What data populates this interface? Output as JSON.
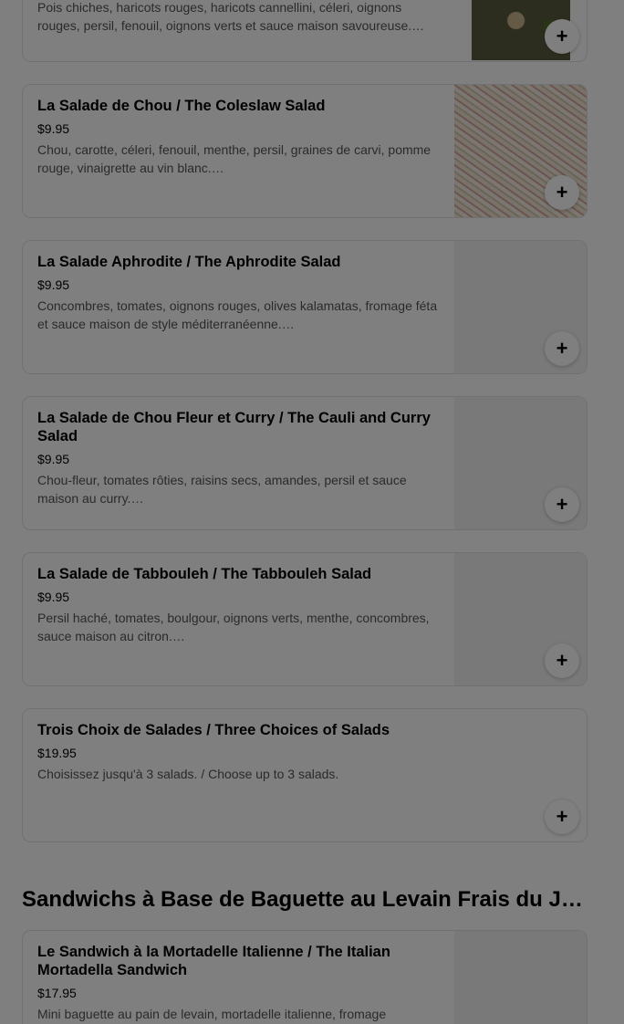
{
  "menu": {
    "items": [
      {
        "title": "",
        "price": "",
        "description": "Pois chiches, haricots rouges, haricots cannellini, céleri, oignons rouges, persil, fenouil, oignons verts et sauce maison savoureuse.…",
        "image": "salad-photo"
      },
      {
        "title": "La Salade de Chou / The Coleslaw Salad",
        "price": "$9.95",
        "description": "Chou, carotte, céleri, fenouil, menthe, persil, graines de carvi, pomme rouge, vinaigrette au vin blanc.…",
        "image": "coleslaw-photo"
      },
      {
        "title": "La Salade Aphrodite / The Aphrodite Salad",
        "price": "$9.95",
        "description": "Concombres, tomates, oignons rouges, olives kalamatas, fromage féta et sauce maison de style méditerranéenne.…",
        "image": ""
      },
      {
        "title": "La Salade de Chou Fleur et Curry / The Cauli and Curry Salad",
        "price": "$9.95",
        "description": "Chou-fleur, tomates rôties, raisins secs, amandes, persil et sauce maison au curry.…",
        "image": ""
      },
      {
        "title": "La Salade de Tabbouleh / The Tabbouleh Salad",
        "price": "$9.95",
        "description": "Persil haché, tomates, boulgour, oignons verts, menthe, concombres, sauce maison au citron.…",
        "image": ""
      },
      {
        "title": "Trois Choix de Salades / Three Choices of Salads",
        "price": "$19.95",
        "description": "Choisissez jusqu'à 3 salads. / Choose up to 3 salads.",
        "image": ""
      }
    ],
    "section_heading": "Sandwichs à Base de Baguette au Levain Frais du Jour /…",
    "section_items": [
      {
        "title": "Le Sandwich à la Mortadelle Italienne / The Italian Mortadella Sandwich",
        "price": "$17.95",
        "description": "Mini baguette au pain de levain, mortadelle italienne, fromage",
        "image": ""
      }
    ],
    "add_label": "+"
  },
  "colors": {
    "overlay": "rgba(0,0,0,0.5)",
    "desc": "#545454",
    "border": "#e2e2e2"
  }
}
